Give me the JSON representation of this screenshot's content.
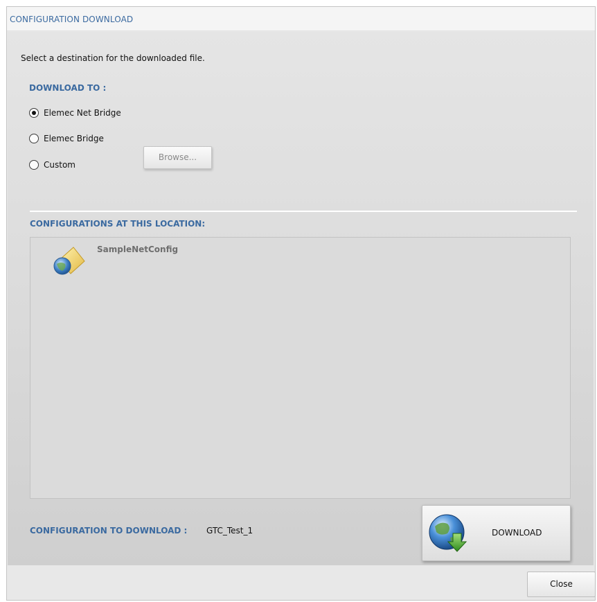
{
  "window": {
    "title": "CONFIGURATION DOWNLOAD"
  },
  "instructions": "Select a destination for the downloaded file.",
  "download_to": {
    "label": "DOWNLOAD TO :",
    "options": [
      {
        "label": "Elemec Net Bridge",
        "checked": true
      },
      {
        "label": "Elemec Bridge",
        "checked": false
      },
      {
        "label": "Custom",
        "checked": false
      }
    ],
    "browse_label": "Browse..."
  },
  "configurations": {
    "label": "CONFIGURATIONS AT THIS LOCATION:",
    "items": [
      {
        "name": "SampleNetConfig",
        "icon": "config-folder-globe-icon"
      }
    ]
  },
  "config_to_download": {
    "label": "CONFIGURATION TO DOWNLOAD :",
    "value": "GTC_Test_1"
  },
  "buttons": {
    "download_label": "DOWNLOAD",
    "download_icon": "globe-download-icon",
    "close_label": "Close"
  },
  "colors": {
    "accent": "#3b6aa0",
    "panel_background": "#dcdcdc",
    "muted_text": "#8a8a8a"
  }
}
